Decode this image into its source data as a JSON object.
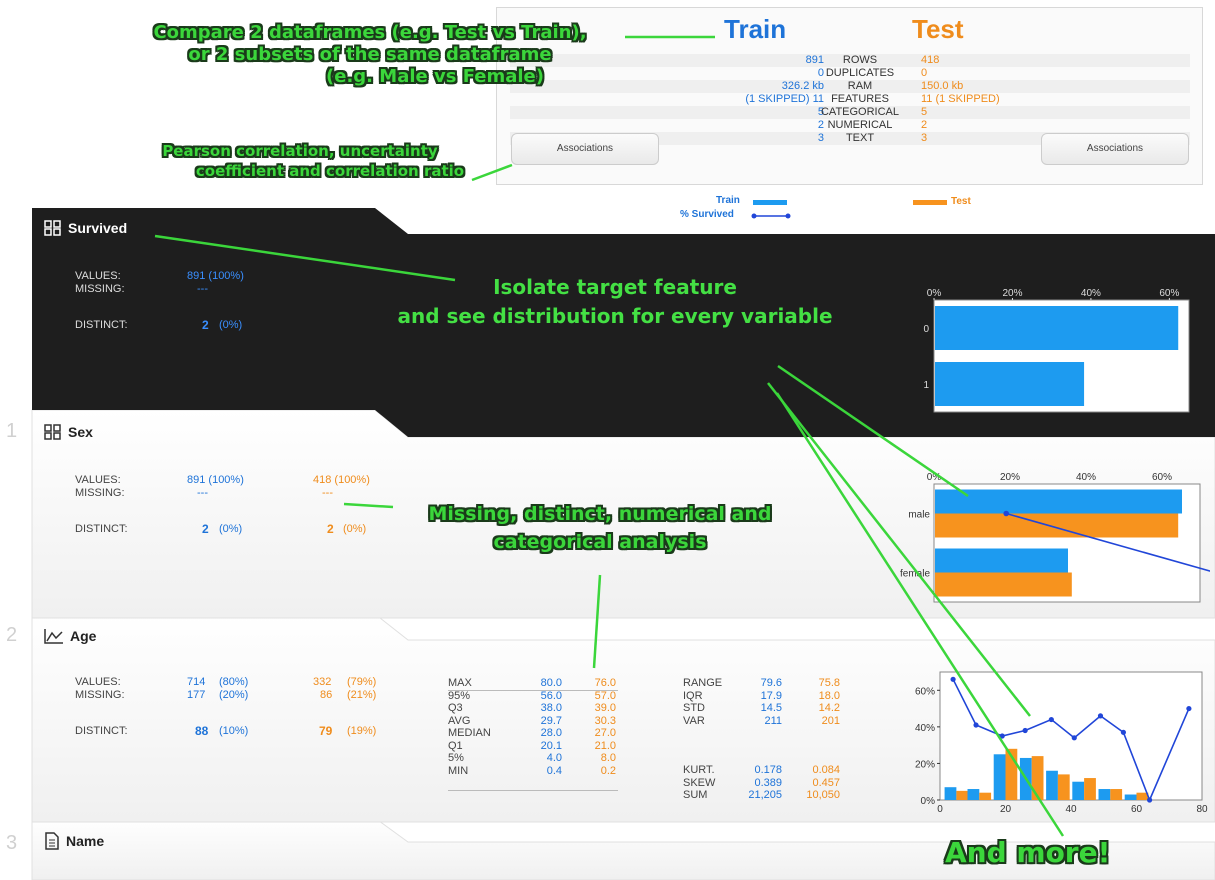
{
  "summary": {
    "train_title": "Train",
    "test_title": "Test",
    "rows": [
      {
        "train": "891",
        "label": "ROWS",
        "test": "418"
      },
      {
        "train": "0",
        "label": "DUPLICATES",
        "test": "0"
      },
      {
        "train": "326.2 kb",
        "label": "RAM",
        "test": "150.0 kb"
      },
      {
        "train": "(1 SKIPPED) 11",
        "label": "FEATURES",
        "test": "11 (1 SKIPPED)"
      },
      {
        "train": "5",
        "label": "CATEGORICAL",
        "test": "5"
      },
      {
        "train": "2",
        "label": "NUMERICAL",
        "test": "2"
      },
      {
        "train": "3",
        "label": "TEXT",
        "test": "3"
      }
    ],
    "associations_label": "Associations",
    "legend": {
      "train": "Train",
      "survived": "% Survived",
      "test": "Test"
    }
  },
  "colors": {
    "train": "#1d9bf0",
    "test": "#f7931e",
    "line": "#2146d8",
    "annotation": "#3bd63b",
    "dark_panel": "#1e1e1e"
  },
  "cards": {
    "survived": {
      "title": "Survived",
      "icon": "grid-icon",
      "values_label": "VALUES:",
      "missing_label": "MISSING:",
      "distinct_label": "DISTINCT:",
      "values": "891 (100%)",
      "missing": "---",
      "distinct": "2",
      "distinct_pct": "(0%)"
    },
    "sex": {
      "index": "1",
      "title": "Sex",
      "icon": "grid-icon",
      "values_label": "VALUES:",
      "missing_label": "MISSING:",
      "distinct_label": "DISTINCT:",
      "train_values": "891 (100%)",
      "test_values": "418 (100%)",
      "train_missing": "---",
      "test_missing": "---",
      "train_distinct": "2",
      "train_distinct_pct": "(0%)",
      "test_distinct": "2",
      "test_distinct_pct": "(0%)"
    },
    "age": {
      "index": "2",
      "title": "Age",
      "icon": "area-chart-icon",
      "values_label": "VALUES:",
      "missing_label": "MISSING:",
      "distinct_label": "DISTINCT:",
      "train_values": "714",
      "train_values_pct": "(80%)",
      "test_values": "332",
      "test_values_pct": "(79%)",
      "train_missing": "177",
      "train_missing_pct": "(20%)",
      "test_missing": "86",
      "test_missing_pct": "(21%)",
      "train_distinct": "88",
      "train_distinct_pct": "(10%)",
      "test_distinct": "79",
      "test_distinct_pct": "(19%)",
      "quantiles": {
        "labels": [
          "MAX",
          "95%",
          "Q3",
          "AVG",
          "MEDIAN",
          "Q1",
          "5%",
          "MIN"
        ],
        "train": [
          "80.0",
          "56.0",
          "38.0",
          "29.7",
          "28.0",
          "20.1",
          "4.0",
          "0.4"
        ],
        "test": [
          "76.0",
          "57.0",
          "39.0",
          "30.3",
          "27.0",
          "21.0",
          "8.0",
          "0.2"
        ]
      },
      "moments": {
        "labels": [
          "RANGE",
          "IQR",
          "STD",
          "VAR",
          "",
          "KURT.",
          "SKEW",
          "SUM"
        ],
        "train": [
          "79.6",
          "17.9",
          "14.5",
          "211",
          "",
          "0.178",
          "0.389",
          "21,205"
        ],
        "test": [
          "75.8",
          "18.0",
          "14.2",
          "201",
          "",
          "0.084",
          "0.457",
          "10,050"
        ]
      }
    },
    "name": {
      "index": "3",
      "title": "Name",
      "icon": "document-icon"
    }
  },
  "chart_data": [
    {
      "type": "bar",
      "orientation": "horizontal",
      "categories": [
        "0",
        "1"
      ],
      "series": [
        {
          "name": "Train",
          "values": [
            0.62,
            0.38
          ]
        }
      ],
      "xlim": [
        0,
        0.65
      ],
      "xticks": [
        "0%",
        "20%",
        "40%",
        "60%"
      ]
    },
    {
      "type": "bar",
      "orientation": "horizontal",
      "categories": [
        "male",
        "female"
      ],
      "series": [
        {
          "name": "Train",
          "values": [
            0.65,
            0.35
          ]
        },
        {
          "name": "Test",
          "values": [
            0.64,
            0.36
          ]
        },
        {
          "name": "% Survived",
          "values": [
            0.19,
            0.74
          ]
        }
      ],
      "xlim": [
        0,
        0.7
      ],
      "xticks": [
        "0%",
        "20%",
        "40%",
        "60%"
      ]
    },
    {
      "type": "bar",
      "x": [
        5,
        12,
        20,
        28,
        36,
        44,
        52,
        60
      ],
      "series": [
        {
          "name": "Train",
          "values": [
            0.07,
            0.06,
            0.25,
            0.23,
            0.16,
            0.1,
            0.06,
            0.03
          ]
        },
        {
          "name": "Test",
          "values": [
            0.05,
            0.04,
            0.28,
            0.24,
            0.14,
            0.12,
            0.06,
            0.04
          ]
        },
        {
          "name": "% Survived",
          "x": [
            4,
            11,
            19,
            26,
            34,
            41,
            49,
            56,
            64,
            76
          ],
          "values": [
            0.66,
            0.41,
            0.35,
            0.38,
            0.44,
            0.34,
            0.46,
            0.37,
            0.0,
            0.5
          ]
        }
      ],
      "xlim": [
        0,
        80
      ],
      "ylim": [
        0,
        0.7
      ],
      "xticks": [
        "0",
        "20",
        "40",
        "60",
        "80"
      ],
      "yticks": [
        "0%",
        "20%",
        "40%",
        "60%"
      ]
    }
  ],
  "annotations": {
    "compare": [
      "Compare 2 dataframes (e.g. Test vs Train),",
      "or 2 subsets of the same dataframe",
      "(e.g. Male vs Female)"
    ],
    "pearson": [
      "Pearson correlation, uncertainty",
      "coefficient and correlation ratio"
    ],
    "isolate": [
      "Isolate target feature",
      "and see distribution for every variable"
    ],
    "missing": [
      "Missing, distinct, numerical and",
      "categorical analysis"
    ],
    "more": "And more!"
  }
}
